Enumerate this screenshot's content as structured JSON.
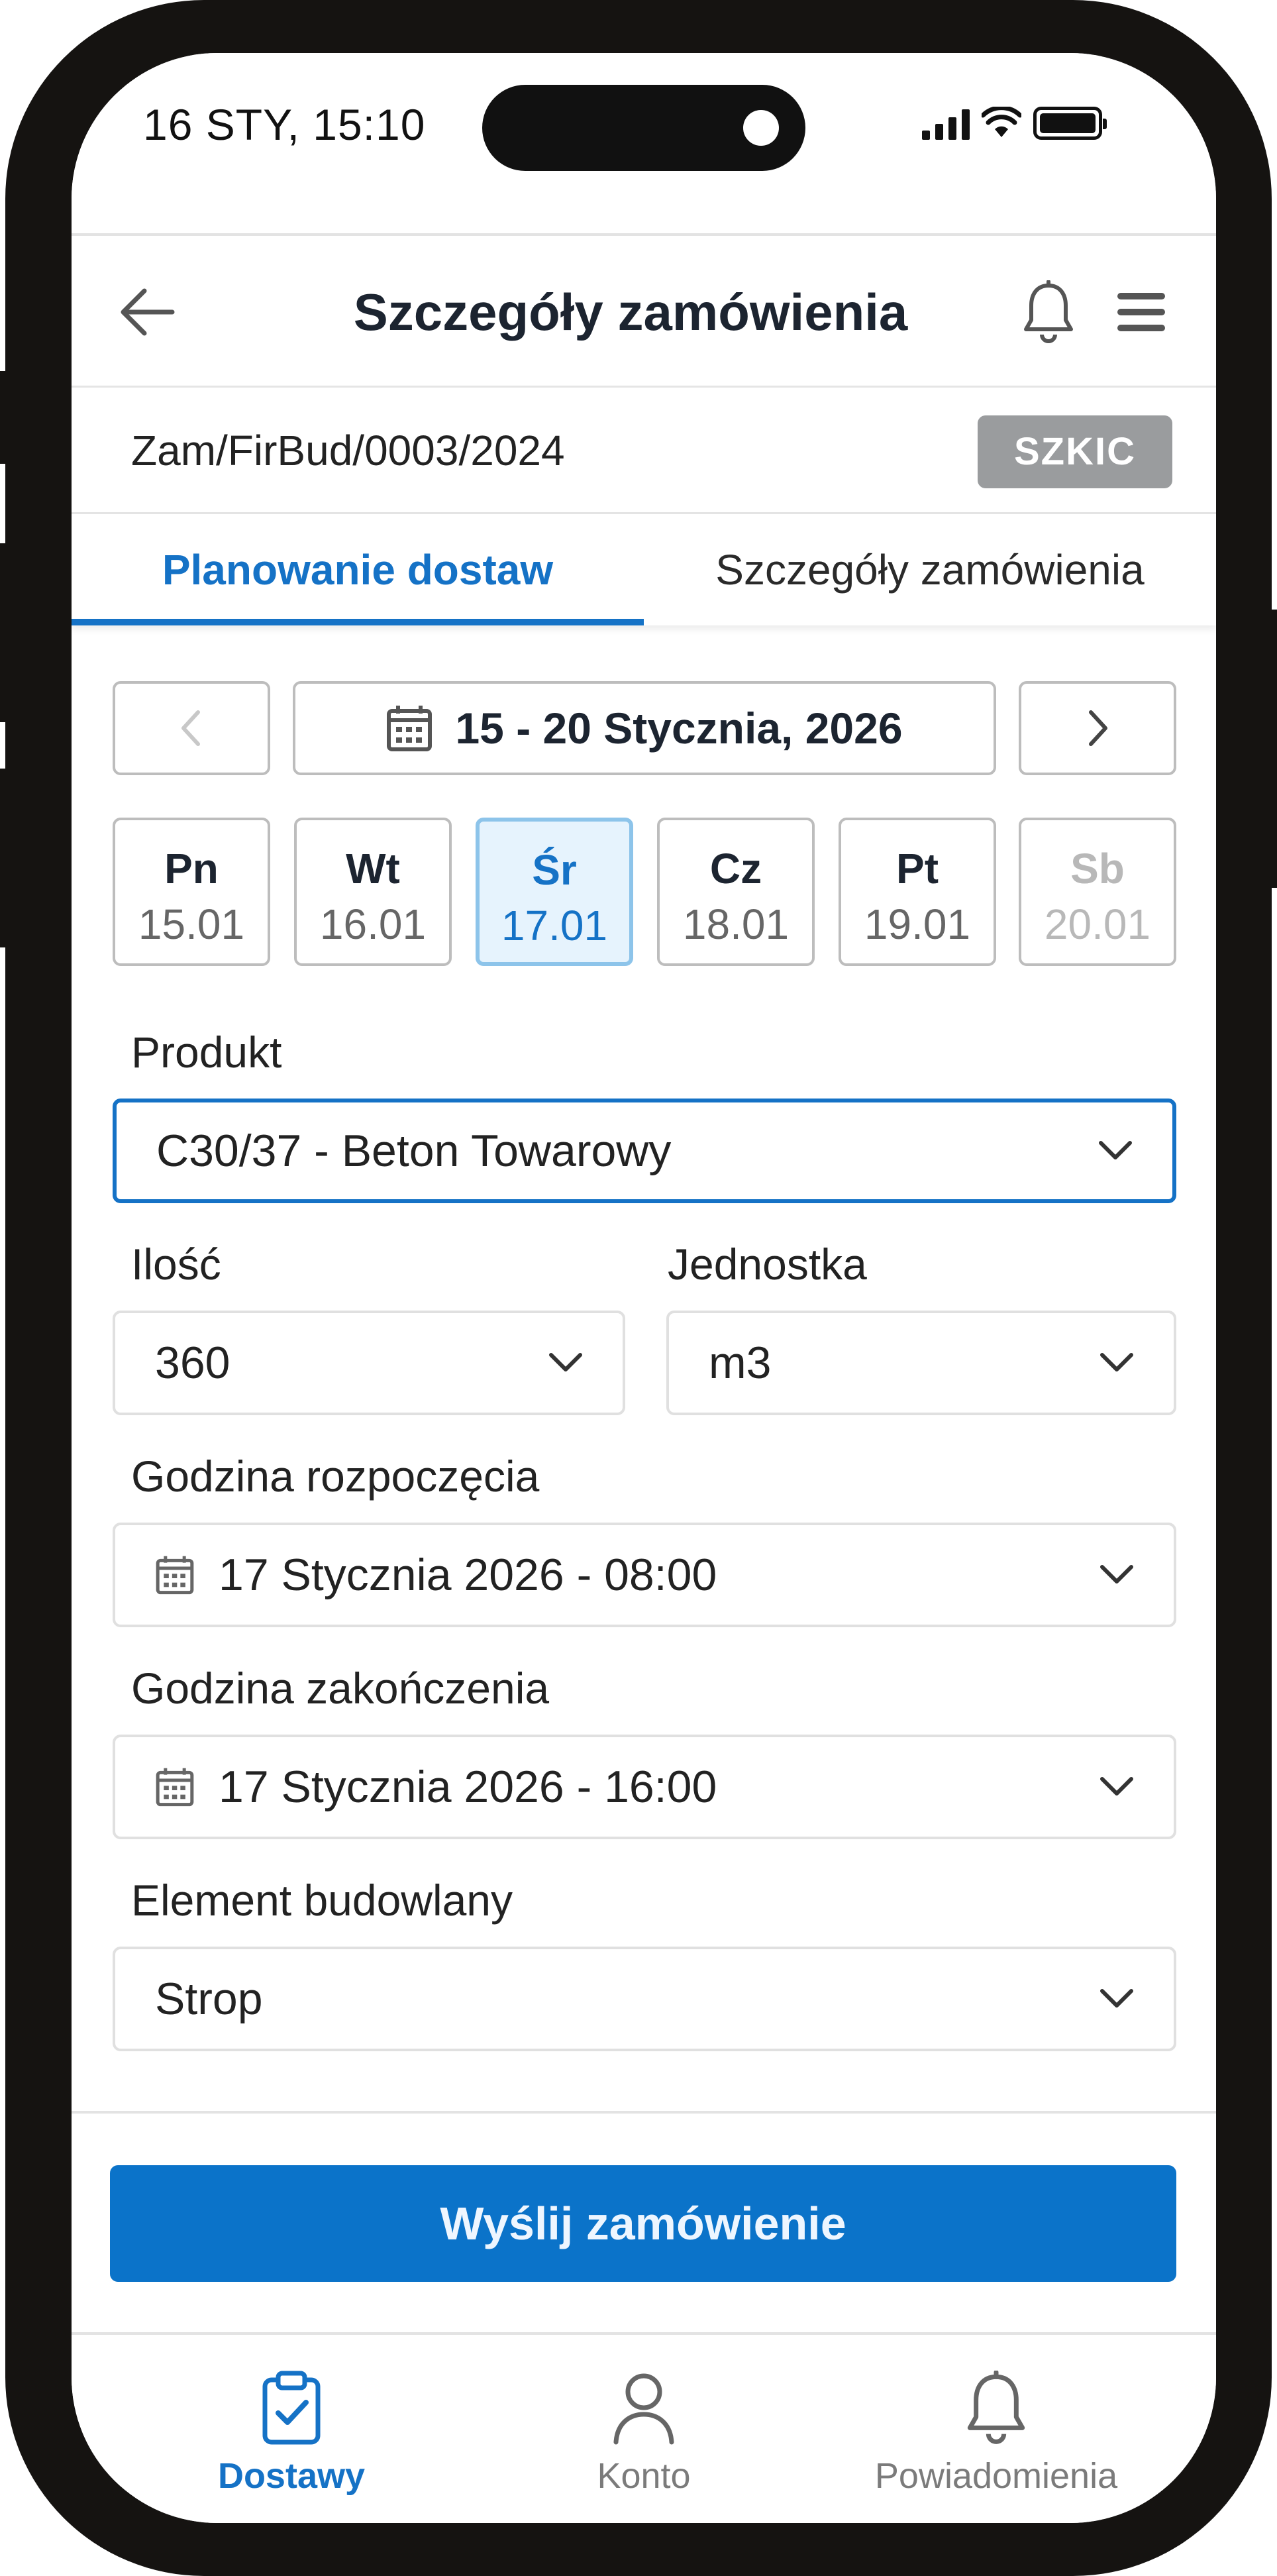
{
  "status_bar": {
    "time": "16 STY, 15:10"
  },
  "header": {
    "title": "Szczegóły zamówienia"
  },
  "order": {
    "number": "Zam/FirBud/0003/2024",
    "status": "SZKIC"
  },
  "tabs": [
    {
      "label": "Planowanie dostaw",
      "active": true
    },
    {
      "label": "Szczegóły zamówienia",
      "active": false
    }
  ],
  "week": {
    "range": "15 - 20 Stycznia, 2026"
  },
  "days": [
    {
      "name": "Pn",
      "date": "15.01"
    },
    {
      "name": "Wt",
      "date": "16.01"
    },
    {
      "name": "Śr",
      "date": "17.01"
    },
    {
      "name": "Cz",
      "date": "18.01"
    },
    {
      "name": "Pt",
      "date": "19.01"
    },
    {
      "name": "Sb",
      "date": "20.01"
    }
  ],
  "form": {
    "product": {
      "label": "Produkt",
      "value": "C30/37 - Beton Towarowy"
    },
    "quantity": {
      "label": "Ilość",
      "value": "360"
    },
    "unit": {
      "label": "Jednostka",
      "value": "m3"
    },
    "start": {
      "label": "Godzina rozpoczęcia",
      "value": "17 Stycznia 2026 - 08:00"
    },
    "end": {
      "label": "Godzina zakończenia",
      "value": "17 Stycznia 2026 - 16:00"
    },
    "element": {
      "label": "Element budowlany",
      "value": "Strop"
    }
  },
  "submit_label": "Wyślij zamówienie",
  "bottom_nav": [
    {
      "label": "Dostawy",
      "icon": "clipboard-check-icon",
      "active": true
    },
    {
      "label": "Konto",
      "icon": "user-icon",
      "active": false
    },
    {
      "label": "Powiadomienia",
      "icon": "bell-icon",
      "active": false
    }
  ],
  "colors": {
    "accent": "#1572c6",
    "button": "#0b73c9",
    "badge": "#9a9c9e",
    "selected_day_bg": "#e6f3fd"
  }
}
